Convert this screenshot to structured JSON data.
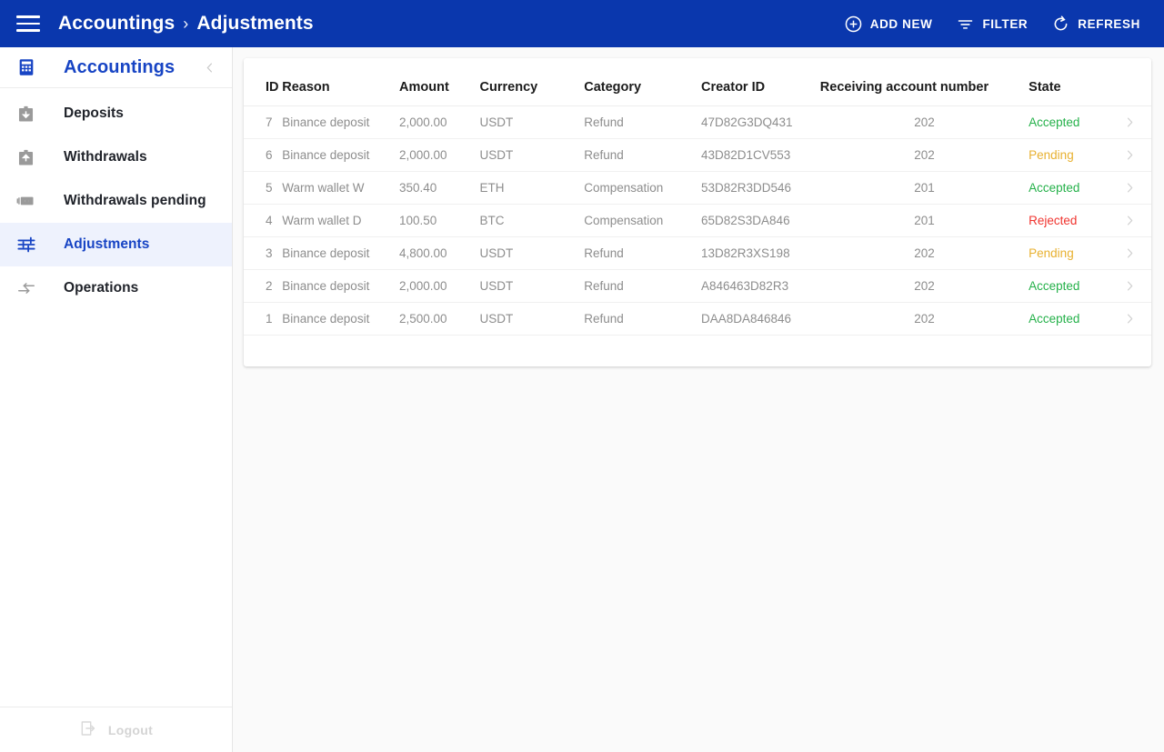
{
  "appbar": {
    "menu_icon": "hamburger-menu-icon",
    "breadcrumb": {
      "root": "Accountings",
      "separator": "›",
      "current": "Adjustments"
    },
    "actions": [
      {
        "label": "ADD NEW",
        "icon": "plus-circle-icon"
      },
      {
        "label": "FILTER",
        "icon": "filter-icon"
      },
      {
        "label": "REFRESH",
        "icon": "refresh-icon"
      }
    ],
    "background_color": "#0a37ad",
    "text_color": "#ffffff"
  },
  "sidebar": {
    "title": "Accountings",
    "title_icon": "calculator-icon",
    "collapse_icon": "chevron-left-icon",
    "accent_color": "#1744c4",
    "active_background": "#eef2fd",
    "items": [
      {
        "label": "Deposits",
        "icon": "box-arrow-down-icon",
        "active": false
      },
      {
        "label": "Withdrawals",
        "icon": "box-arrow-up-icon",
        "active": false
      },
      {
        "label": "Withdrawals pending",
        "icon": "banknote-icon",
        "active": false
      },
      {
        "label": "Adjustments",
        "icon": "tune-sliders-icon",
        "active": true
      },
      {
        "label": "Operations",
        "icon": "swap-arrows-icon",
        "active": false
      }
    ],
    "footer": {
      "label": "Logout",
      "icon": "logout-icon",
      "disabled": true
    }
  },
  "table": {
    "columns": [
      {
        "key": "id",
        "label": "ID"
      },
      {
        "key": "reason",
        "label": "Reason"
      },
      {
        "key": "amount",
        "label": "Amount"
      },
      {
        "key": "currency",
        "label": "Currency"
      },
      {
        "key": "category",
        "label": "Category"
      },
      {
        "key": "creator",
        "label": "Creator ID"
      },
      {
        "key": "receiving",
        "label": "Receiving account number"
      },
      {
        "key": "state",
        "label": "State"
      }
    ],
    "row_chevron_icon": "chevron-right-icon",
    "state_colors": {
      "Accepted": "#25b14a",
      "Pending": "#e8b131",
      "Rejected": "#f0342f"
    },
    "rows": [
      {
        "id": "7",
        "reason": "Binance deposit",
        "amount": "2,000.00",
        "currency": "USDT",
        "category": "Refund",
        "creator": "47D82G3DQ431",
        "receiving": "202",
        "state": "Accepted"
      },
      {
        "id": "6",
        "reason": "Binance deposit",
        "amount": "2,000.00",
        "currency": "USDT",
        "category": "Refund",
        "creator": "43D82D1CV553",
        "receiving": "202",
        "state": "Pending"
      },
      {
        "id": "5",
        "reason": "Warm wallet W",
        "amount": "350.40",
        "currency": "ETH",
        "category": "Compensation",
        "creator": "53D82R3DD546",
        "receiving": "201",
        "state": "Accepted"
      },
      {
        "id": "4",
        "reason": "Warm wallet D",
        "amount": "100.50",
        "currency": "BTC",
        "category": "Compensation",
        "creator": "65D82S3DA846",
        "receiving": "201",
        "state": "Rejected"
      },
      {
        "id": "3",
        "reason": "Binance deposit",
        "amount": "4,800.00",
        "currency": "USDT",
        "category": "Refund",
        "creator": "13D82R3XS198",
        "receiving": "202",
        "state": "Pending"
      },
      {
        "id": "2",
        "reason": "Binance deposit",
        "amount": "2,000.00",
        "currency": "USDT",
        "category": "Refund",
        "creator": "A846463D82R3",
        "receiving": "202",
        "state": "Accepted"
      },
      {
        "id": "1",
        "reason": "Binance deposit",
        "amount": "2,500.00",
        "currency": "USDT",
        "category": "Refund",
        "creator": "DAA8DA846846",
        "receiving": "202",
        "state": "Accepted"
      }
    ]
  }
}
